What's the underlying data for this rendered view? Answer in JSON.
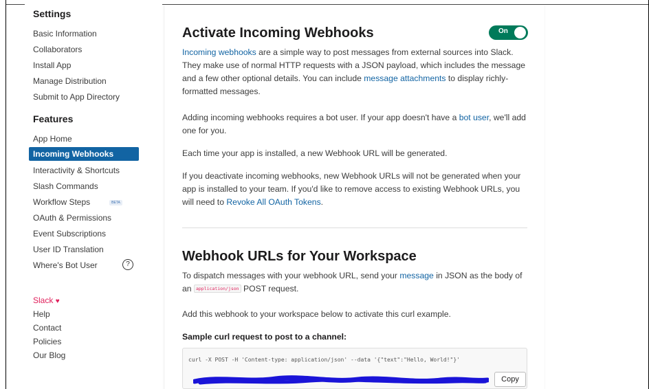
{
  "sidebar": {
    "settings_title": "Settings",
    "settings_items": [
      {
        "label": "Basic Information"
      },
      {
        "label": "Collaborators"
      },
      {
        "label": "Install App"
      },
      {
        "label": "Manage Distribution"
      },
      {
        "label": "Submit to App Directory"
      }
    ],
    "features_title": "Features",
    "features_items": [
      {
        "label": "App Home"
      },
      {
        "label": "Incoming Webhooks",
        "active": true
      },
      {
        "label": "Interactivity & Shortcuts"
      },
      {
        "label": "Slash Commands"
      },
      {
        "label": "Workflow Steps",
        "badge": "BETA"
      },
      {
        "label": "OAuth & Permissions"
      },
      {
        "label": "Event Subscriptions"
      },
      {
        "label": "User ID Translation"
      },
      {
        "label": "Where's Bot User",
        "icon": "help-circle-icon"
      }
    ],
    "footer_items": [
      {
        "label": "Slack",
        "icon": "heart-icon"
      },
      {
        "label": "Help"
      },
      {
        "label": "Contact"
      },
      {
        "label": "Policies"
      },
      {
        "label": "Our Blog"
      }
    ]
  },
  "main": {
    "activate": {
      "title": "Activate Incoming Webhooks",
      "toggle_label": "On",
      "p1_link1": "Incoming webhooks",
      "p1_text1": " are a simple way to post messages from external sources into Slack. They make use of normal HTTP requests with a JSON payload, which includes the message and a few other optional details. You can include ",
      "p1_link2": "message attachments",
      "p1_text2": " to display richly-formatted messages.",
      "p2_text1": "Adding incoming webhooks requires a bot user. If your app doesn't have a ",
      "p2_link": "bot user",
      "p2_text2": ", we'll add one for you.",
      "p3": "Each time your app is installed, a new Webhook URL will be generated.",
      "p4_text1": "If you deactivate incoming webhooks, new Webhook URLs will not be generated when your app is installed to your team. If you'd like to remove access to existing Webhook URLs, you will need to ",
      "p4_link": "Revoke All OAuth Tokens",
      "p4_text2": "."
    },
    "urls": {
      "title": "Webhook URLs for Your Workspace",
      "p1_text1": "To dispatch messages with your webhook URL, send your ",
      "p1_link": "message",
      "p1_text2": " in JSON as the body of an ",
      "p1_code": "application/json",
      "p1_text3": " POST request.",
      "p2": "Add this webhook to your workspace below to activate this curl example.",
      "sample_label": "Sample curl request to post to a channel:",
      "curl_text": "curl -X POST -H 'Content-type: application/json' --data '{\"text\":\"Hello, World!\"}'",
      "copy_label": "Copy"
    }
  },
  "colors": {
    "accent": "#1264a3",
    "toggle_on": "#007a5a",
    "slack_pink": "#e01e5a",
    "redaction": "#1a14d8"
  }
}
